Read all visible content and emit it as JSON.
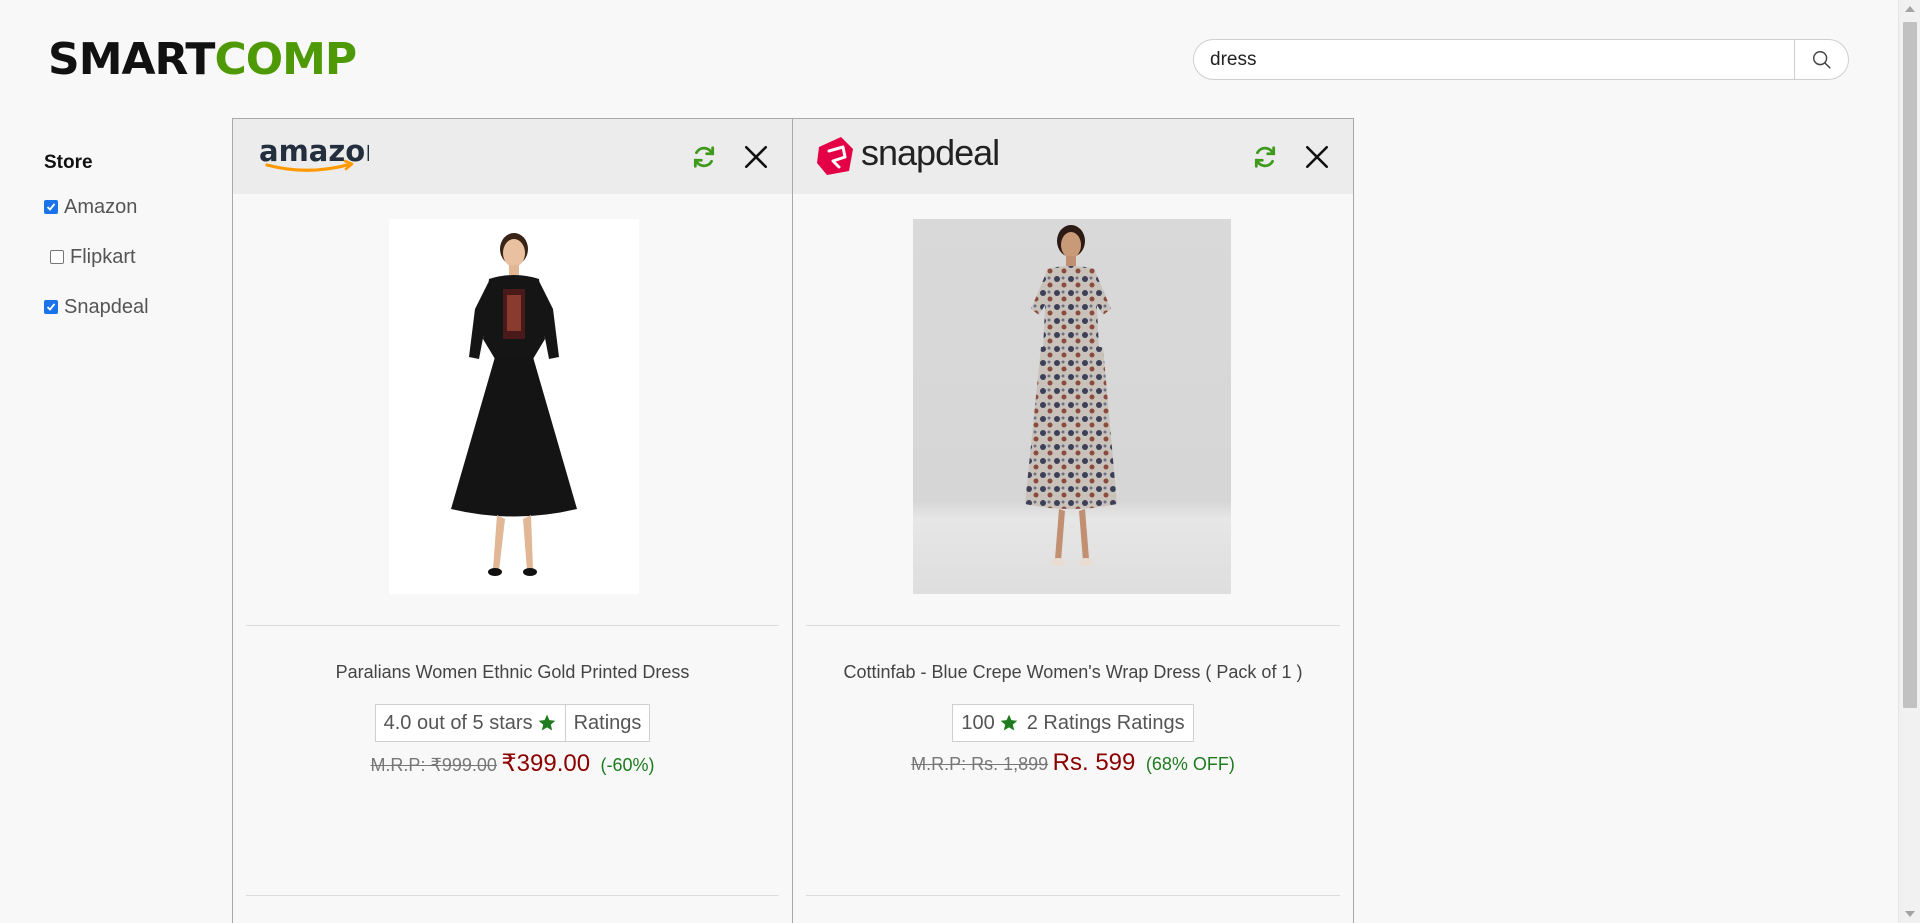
{
  "brand": {
    "part1": "SMART",
    "part2": "COMP",
    "accent": "#4e9a06"
  },
  "search": {
    "value": "dress",
    "icon": "search-icon"
  },
  "sidebar": {
    "heading": "Store",
    "stores": [
      {
        "label": "Amazon",
        "checked": true
      },
      {
        "label": "Flipkart",
        "checked": false
      },
      {
        "label": "Snapdeal",
        "checked": true
      }
    ]
  },
  "panels": [
    {
      "store": "amazon",
      "product": {
        "title": "Paralians Women Ethnic Gold Printed Dress",
        "rating_value": "4.0 out of 5 stars",
        "rating_label": "Ratings",
        "mrp": "M.R.P: ₹999.00",
        "price": "₹399.00",
        "discount": "(-60%)"
      }
    },
    {
      "store": "snapdeal",
      "product": {
        "title": "Cottinfab - Blue Crepe Women's Wrap Dress ( Pack of 1 )",
        "rating_value": "100",
        "rating_label": "2 Ratings Ratings",
        "mrp": "M.R.P: Rs. 1,899",
        "price": "Rs. 599",
        "discount": "(68% OFF)"
      }
    }
  ],
  "colors": {
    "price": "#8b0000",
    "discount": "#1e7b1e",
    "star": "#1e7b1e",
    "refresh": "#3f9a1c"
  }
}
